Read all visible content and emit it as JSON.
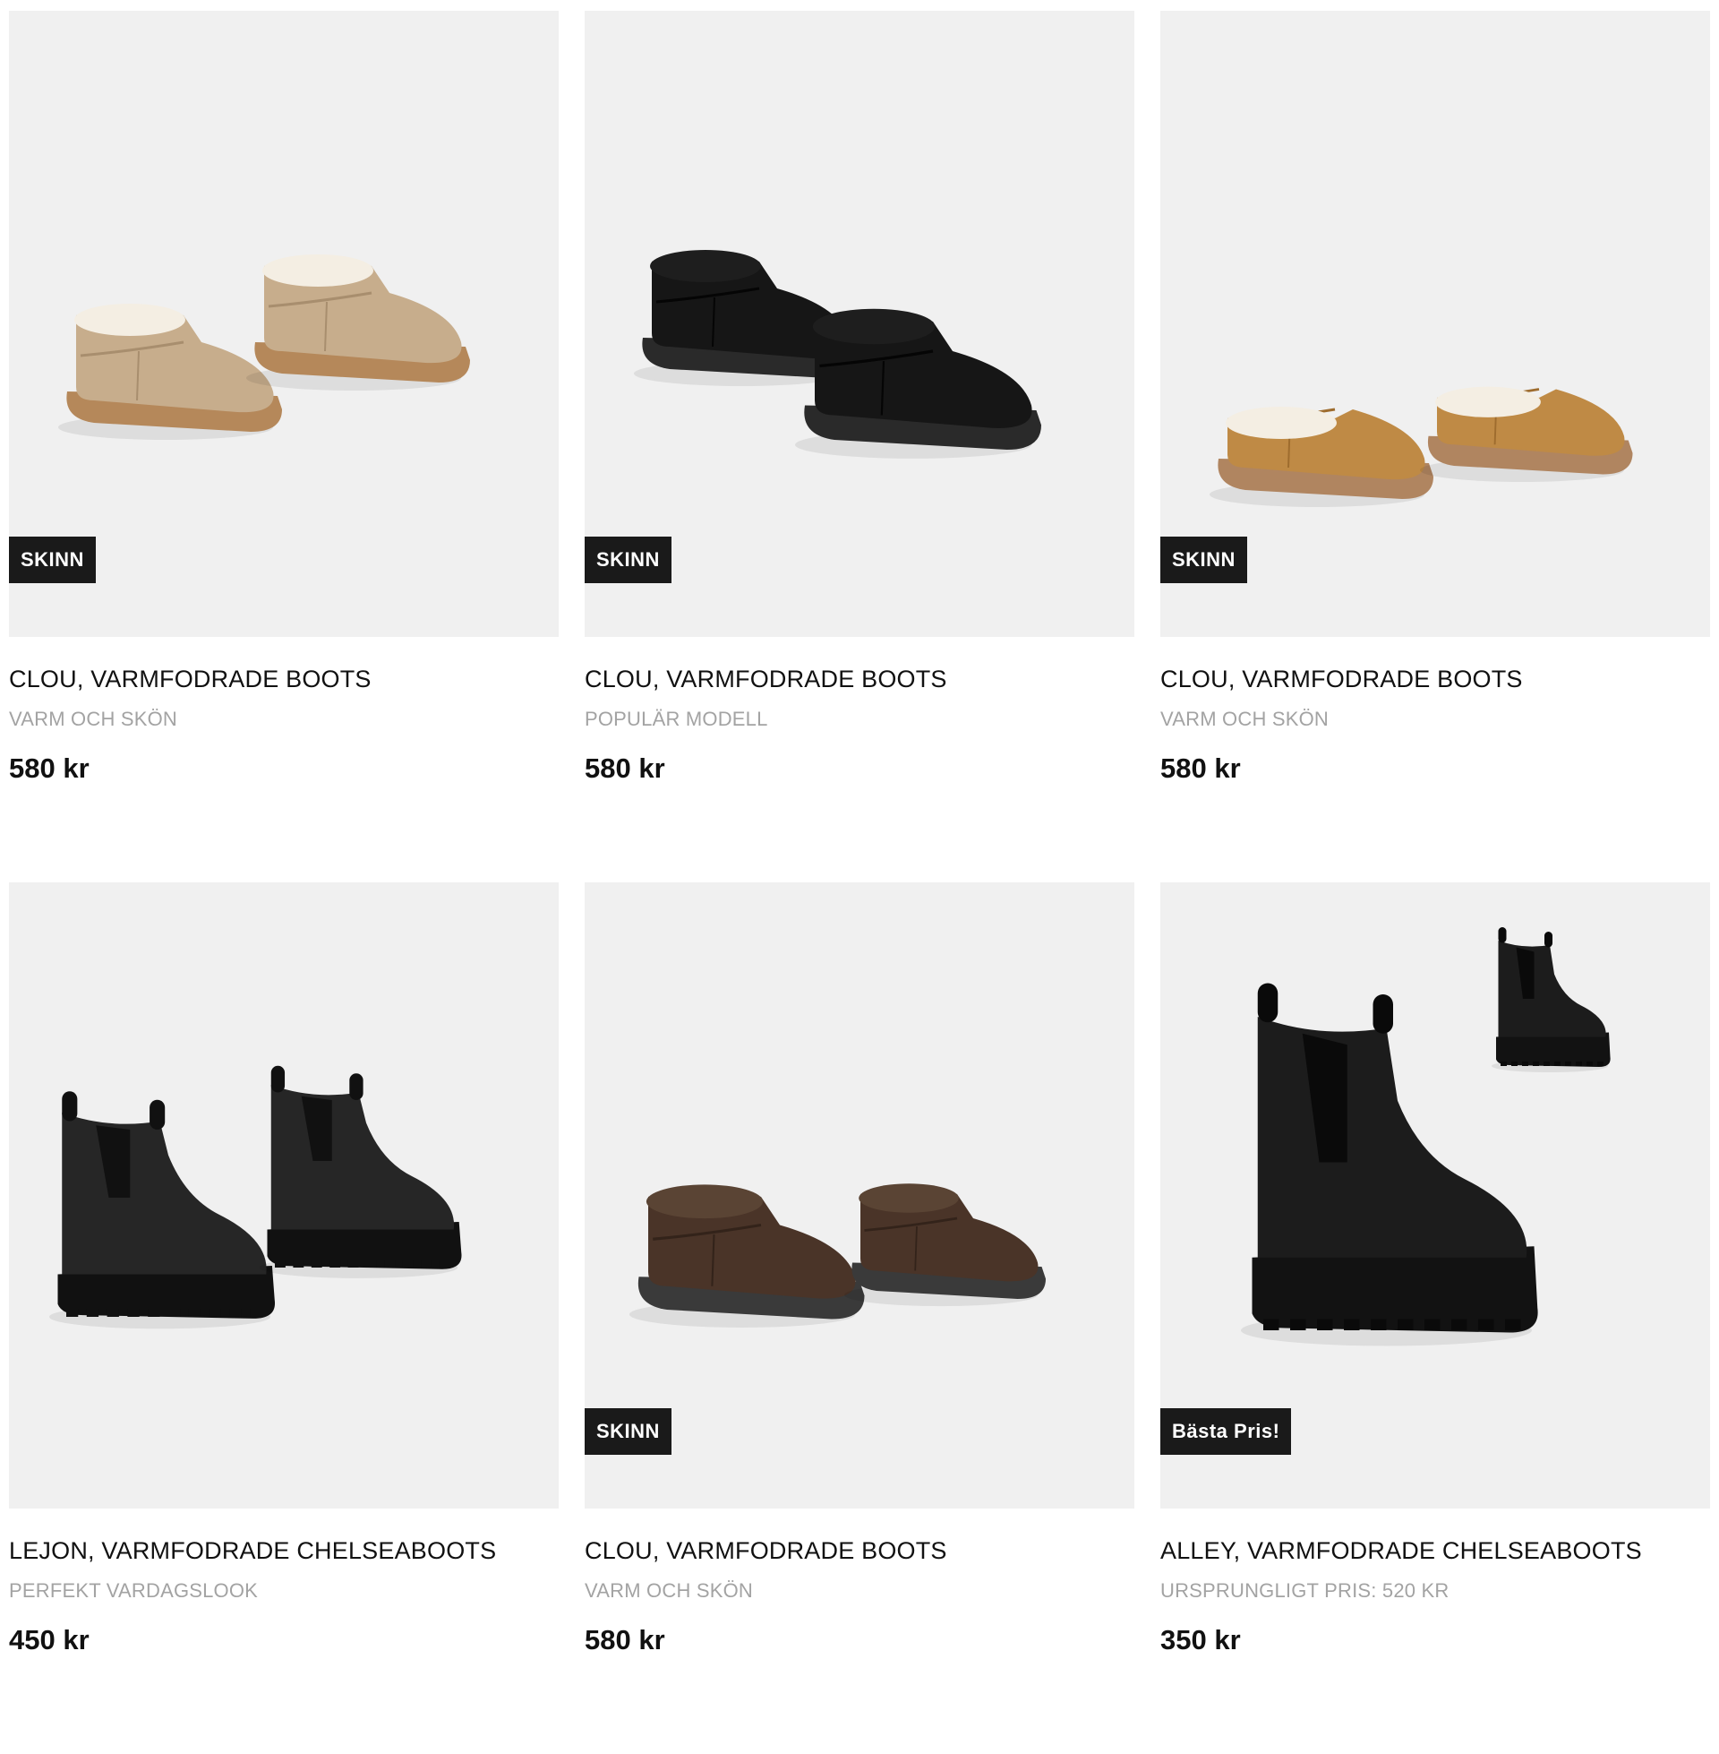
{
  "products": [
    {
      "name": "CLOU, VARMFODRADE BOOTS",
      "subtitle": "VARM OCH SKÖN",
      "price": "580 kr",
      "badge": "SKINN",
      "image": "beige-mini-boots",
      "colors": {
        "upper": "#c7ad8c",
        "upper_dark": "#a88e6e",
        "sole": "#b5885a",
        "lining": "#f4eee3"
      }
    },
    {
      "name": "CLOU, VARMFODRADE BOOTS",
      "subtitle": "POPULÄR MODELL",
      "price": "580 kr",
      "badge": "SKINN",
      "image": "black-mini-boots",
      "colors": {
        "upper": "#161616",
        "upper_dark": "#050505",
        "sole": "#2a2a2a",
        "lining": "#1e1e1e"
      }
    },
    {
      "name": "CLOU, VARMFODRADE BOOTS",
      "subtitle": "VARM OCH SKÖN",
      "price": "580 kr",
      "badge": "SKINN",
      "image": "chestnut-ultra-mini-boots",
      "colors": {
        "upper": "#bf8a45",
        "upper_dark": "#9e6c2e",
        "sole": "#b08560",
        "lining": "#f4eee3"
      }
    },
    {
      "name": "LEJON, VARMFODRADE CHELSEABOOTS",
      "subtitle": "PERFEKT VARDAGSLOOK",
      "price": "450 kr",
      "badge": "",
      "image": "black-chelsea-boots",
      "colors": {
        "upper": "#262626",
        "upper_dark": "#111111",
        "sole": "#111111",
        "lining": "#1a1a1a"
      }
    },
    {
      "name": "CLOU, VARMFODRADE BOOTS",
      "subtitle": "VARM OCH SKÖN",
      "price": "580 kr",
      "badge": "SKINN",
      "image": "brown-mini-boots",
      "colors": {
        "upper": "#4a3428",
        "upper_dark": "#33231a",
        "sole": "#3a3a3a",
        "lining": "#5a4434"
      }
    },
    {
      "name": "ALLEY, VARMFODRADE CHELSEABOOTS",
      "subtitle": "URSPRUNGLIGT PRIS: 520 KR",
      "price": "350 kr",
      "badge": "Bästa Pris!",
      "image": "black-platform-chelsea-boots",
      "colors": {
        "upper": "#1c1c1c",
        "upper_dark": "#0a0a0a",
        "sole": "#121212",
        "lining": "#1a1a1a"
      }
    }
  ]
}
